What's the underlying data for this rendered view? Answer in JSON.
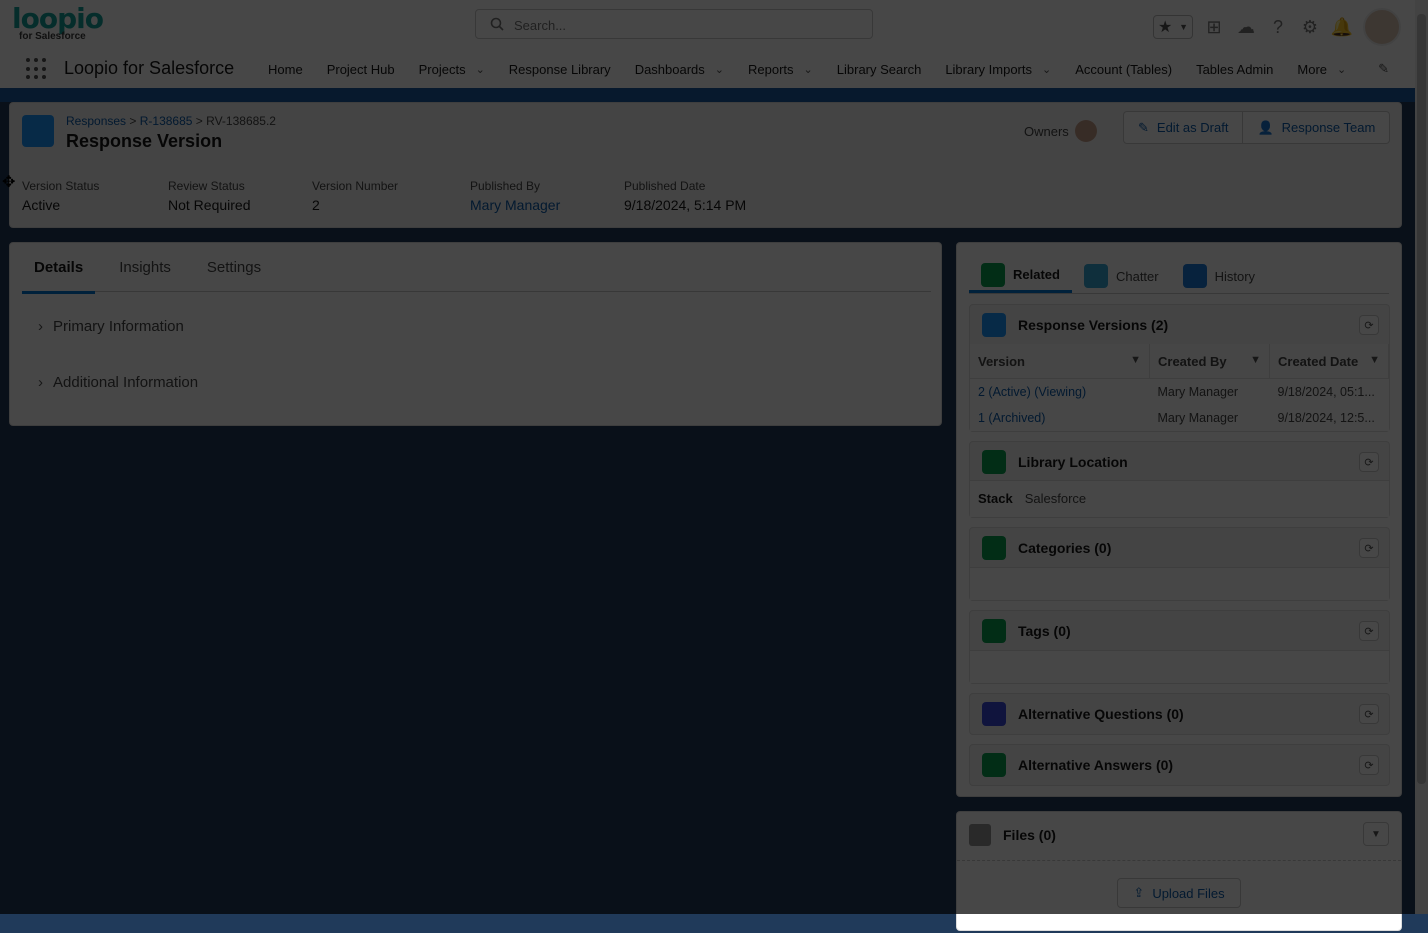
{
  "brand": {
    "logo_text": "loopio",
    "logo_sub": "for Salesforce",
    "app_name": "Loopio for Salesforce"
  },
  "search": {
    "placeholder": "Search..."
  },
  "nav": {
    "items": [
      {
        "label": "Home",
        "has_menu": false
      },
      {
        "label": "Project Hub",
        "has_menu": false
      },
      {
        "label": "Projects",
        "has_menu": true
      },
      {
        "label": "Response Library",
        "has_menu": false
      },
      {
        "label": "Dashboards",
        "has_menu": true
      },
      {
        "label": "Reports",
        "has_menu": true
      },
      {
        "label": "Library Search",
        "has_menu": false
      },
      {
        "label": "Library Imports",
        "has_menu": true
      },
      {
        "label": "Account (Tables)",
        "has_menu": false
      },
      {
        "label": "Tables Admin",
        "has_menu": false
      },
      {
        "label": "More",
        "has_menu": true
      }
    ]
  },
  "record": {
    "breadcrumbs": [
      "Responses",
      "R-138685",
      "RV-138685.2"
    ],
    "title": "Response Version",
    "owners_label": "Owners",
    "buttons": {
      "edit_draft": "Edit as Draft",
      "response_team": "Response Team"
    },
    "fields": {
      "version_status_label": "Version Status",
      "version_status": "Active",
      "review_status_label": "Review Status",
      "review_status": "Not Required",
      "version_number_label": "Version Number",
      "version_number": "2",
      "published_by_label": "Published By",
      "published_by": "Mary Manager",
      "published_date_label": "Published Date",
      "published_date": "9/18/2024, 5:14 PM"
    }
  },
  "left_tabs": [
    "Details",
    "Insights",
    "Settings"
  ],
  "sections": [
    "Primary Information",
    "Additional Information"
  ],
  "right_tabs": [
    "Related",
    "Chatter",
    "History"
  ],
  "related": {
    "response_versions": {
      "title": "Response Versions (2)",
      "columns": [
        "Version",
        "Created By",
        "Created Date"
      ],
      "rows": [
        [
          "2 (Active) (Viewing)",
          "Mary Manager",
          "9/18/2024, 05:1..."
        ],
        [
          "1 (Archived)",
          "Mary Manager",
          "9/18/2024, 12:5..."
        ]
      ]
    },
    "library_location": {
      "title": "Library Location",
      "stack_label": "Stack",
      "stack_value": "Salesforce"
    },
    "categories": {
      "title": "Categories (0)"
    },
    "tags": {
      "title": "Tags (0)"
    },
    "alt_questions": {
      "title": "Alternative Questions (0)"
    },
    "alt_answers": {
      "title": "Alternative Answers (0)"
    }
  },
  "files": {
    "title": "Files (0)",
    "upload_label": "Upload Files"
  },
  "colors": {
    "brand": "#12a39a",
    "link": "#0b5cab",
    "accent": "#0176d3"
  }
}
